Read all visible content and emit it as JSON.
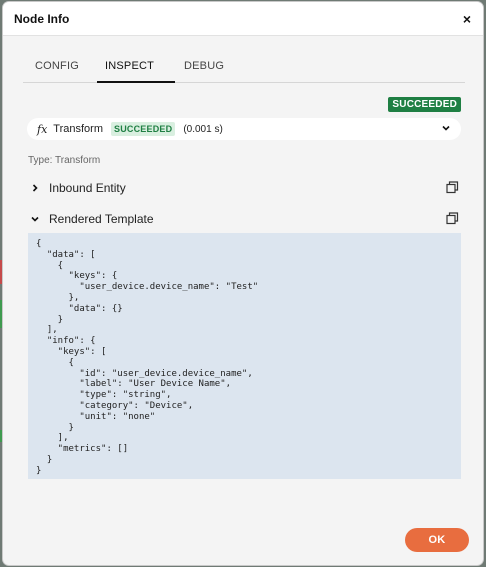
{
  "dialog": {
    "title": "Node Info",
    "close_label": "×"
  },
  "tabs": [
    {
      "label": "CONFIG",
      "active": false
    },
    {
      "label": "INSPECT",
      "active": true
    },
    {
      "label": "DEBUG",
      "active": false
    }
  ],
  "status": {
    "badge": "SUCCEEDED",
    "color": "#1f7f43"
  },
  "node": {
    "icon_text": "fx",
    "name": "Transform",
    "status_badge": "SUCCEEDED",
    "duration": "(0.001 s)",
    "expand_icon": "chevron-down-icon"
  },
  "type_label": "Type: Transform",
  "sections": [
    {
      "label": "Inbound Entity",
      "expanded": false,
      "icon": "chevron-right-icon",
      "action_icon": "copy-icon"
    },
    {
      "label": "Rendered Template",
      "expanded": true,
      "icon": "chevron-down-icon",
      "action_icon": "copy-icon"
    }
  ],
  "rendered_template": "{\n  \"data\": [\n    {\n      \"keys\": {\n        \"user_device.device_name\": \"Test\"\n      },\n      \"data\": {}\n    }\n  ],\n  \"info\": {\n    \"keys\": [\n      {\n        \"id\": \"user_device.device_name\",\n        \"label\": \"User Device Name\",\n        \"type\": \"string\",\n        \"category\": \"Device\",\n        \"unit\": \"none\"\n      }\n    ],\n    \"metrics\": []\n  }\n}",
  "footer": {
    "ok_label": "OK",
    "ok_color": "#e86d3f"
  }
}
